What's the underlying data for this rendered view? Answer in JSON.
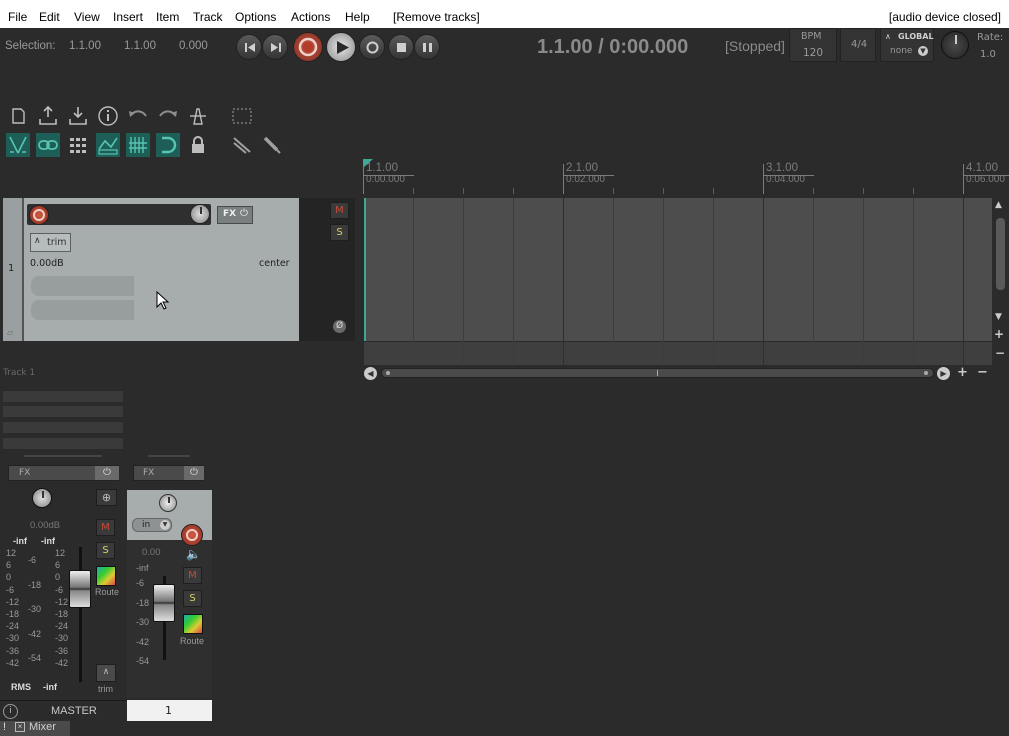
{
  "menubar": {
    "items": [
      "File",
      "Edit",
      "View",
      "Insert",
      "Item",
      "Track",
      "Options",
      "Actions",
      "Help"
    ],
    "action_hint": "[Remove tracks]",
    "status": "[audio device closed]"
  },
  "transport": {
    "selection_label": "Selection:",
    "sel_start": "1.1.00",
    "sel_end": "1.1.00",
    "sel_length": "0.000",
    "time_display": "1.1.00 / 0:00.000",
    "play_state": "[Stopped]",
    "bpm_label": "BPM",
    "bpm_value": "120",
    "time_sig": "4/4",
    "global_label": "GLOBAL",
    "global_mode": "none",
    "rate_label": "Rate:",
    "rate_value": "1.0"
  },
  "ruler": {
    "marks": [
      {
        "bar": "1.1.00",
        "time": "0:00.000"
      },
      {
        "bar": "2.1.00",
        "time": "0:02.000"
      },
      {
        "bar": "3.1.00",
        "time": "0:04.000"
      },
      {
        "bar": "4.1.00",
        "time": "0:06.000"
      }
    ]
  },
  "track": {
    "number": "1",
    "fx_label": "FX",
    "trim_label": "trim",
    "volume": "0.00dB",
    "pan": "center",
    "mute": "M",
    "solo": "S",
    "name_hint": "Track 1"
  },
  "mixer": {
    "master": {
      "fx_label": "FX",
      "volume": "0.00dB",
      "peak_l": "-inf",
      "peak_r": "-inf",
      "scale_outer": [
        "12",
        "6",
        "0",
        "-6",
        "-12",
        "-18",
        "-24",
        "-30",
        "-36",
        "-42"
      ],
      "scale_inner": [
        "-6",
        "-18",
        "-30",
        "-42",
        "-54"
      ],
      "rms_label": "RMS",
      "rms_value": "-inf",
      "mute": "M",
      "solo": "S",
      "route_label": "Route",
      "trim_label": "trim",
      "name": "MASTER"
    },
    "track1": {
      "fx_label": "FX",
      "input": "in",
      "volume": "0.00",
      "peak": "-inf",
      "scale": [
        "-6",
        "-18",
        "-30",
        "-42",
        "-54"
      ],
      "mute": "M",
      "solo": "S",
      "route_label": "Route",
      "name": "1"
    },
    "tab_label": "Mixer"
  },
  "colors": {
    "accent_teal": "#1d5e57",
    "record_red": "#b43a2a",
    "tcp_bg": "#a7acad"
  }
}
